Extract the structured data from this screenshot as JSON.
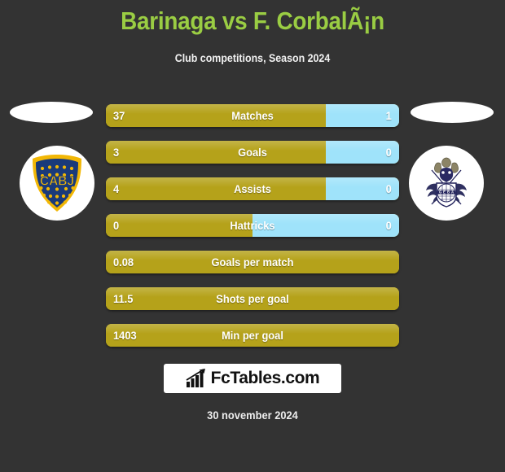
{
  "header": {
    "title": "Barinaga vs F. CorbalÃ¡n",
    "subtitle": "Club competitions, Season 2024"
  },
  "teams": {
    "home": {
      "crest_name": "boca-juniors-crest",
      "crest_text": "CABJ"
    },
    "away": {
      "crest_name": "gimnasia-la-plata-crest",
      "crest_text": ""
    }
  },
  "stats": {
    "rows": [
      {
        "label": "Matches",
        "home": "37",
        "away": "1",
        "home_pct": 75,
        "away_pct": 25,
        "split": true
      },
      {
        "label": "Goals",
        "home": "3",
        "away": "0",
        "home_pct": 75,
        "away_pct": 25,
        "split": true
      },
      {
        "label": "Assists",
        "home": "4",
        "away": "0",
        "home_pct": 75,
        "away_pct": 25,
        "split": true
      },
      {
        "label": "Hattricks",
        "home": "0",
        "away": "0",
        "home_pct": 50,
        "away_pct": 50,
        "split": true
      },
      {
        "label": "Goals per match",
        "home": "0.08",
        "away": "",
        "home_pct": 100,
        "away_pct": 0,
        "split": false
      },
      {
        "label": "Shots per goal",
        "home": "11.5",
        "away": "",
        "home_pct": 100,
        "away_pct": 0,
        "split": false
      },
      {
        "label": "Min per goal",
        "home": "1403",
        "away": "",
        "home_pct": 100,
        "away_pct": 0,
        "split": false
      }
    ]
  },
  "footer": {
    "brand": "FcTables.com",
    "brand_icon": "bar-chart-arrow-icon",
    "date": "30 november 2024"
  },
  "colors": {
    "background": "#333333",
    "title": "#9acd43",
    "home_bar": "#b5a21a",
    "away_bar": "#9fe3fa",
    "text": "#ffffff"
  }
}
